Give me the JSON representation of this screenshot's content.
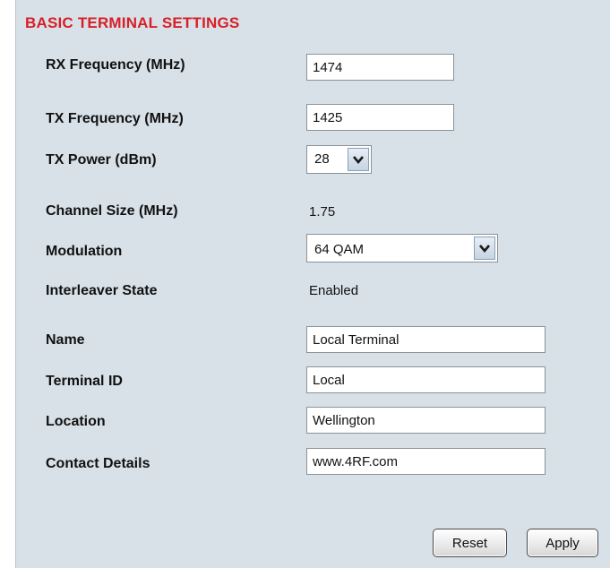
{
  "section": {
    "title": "BASIC TERMINAL SETTINGS"
  },
  "fields": {
    "rx_frequency": {
      "label": "RX Frequency (MHz)",
      "value": "1474"
    },
    "tx_frequency": {
      "label": "TX Frequency (MHz)",
      "value": "1425"
    },
    "tx_power": {
      "label": "TX Power (dBm)",
      "selected": "28"
    },
    "channel_size": {
      "label": "Channel Size (MHz)",
      "value": "1.75"
    },
    "modulation": {
      "label": "Modulation",
      "selected": "64 QAM"
    },
    "interleaver_state": {
      "label": "Interleaver State",
      "value": "Enabled"
    },
    "name": {
      "label": "Name",
      "value": "Local Terminal"
    },
    "terminal_id": {
      "label": "Terminal ID",
      "value": "Local"
    },
    "location": {
      "label": "Location",
      "value": "Wellington"
    },
    "contact_details": {
      "label": "Contact Details",
      "value": "www.4RF.com"
    }
  },
  "buttons": {
    "reset": "Reset",
    "apply": "Apply"
  },
  "icons": {
    "dropdown": "chevron-down-icon"
  },
  "colors": {
    "title": "#d81f26",
    "panel_background": "#d8e1e8"
  }
}
